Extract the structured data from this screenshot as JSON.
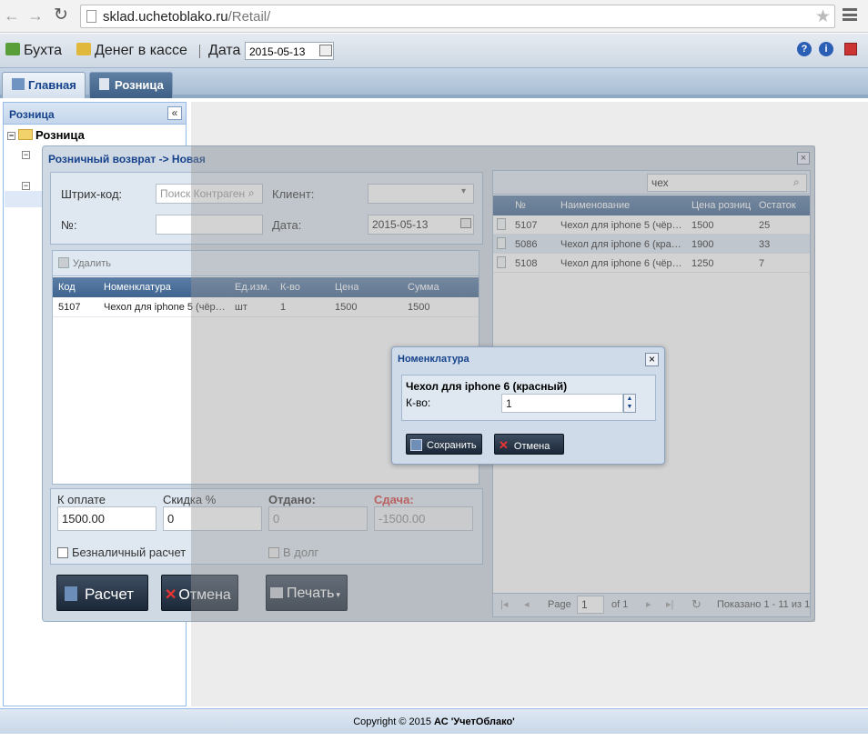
{
  "browser": {
    "url_host": "sklad.uchetoblako.ru",
    "url_path": "/Retail/"
  },
  "toolbar": {
    "buhta_label": "Бухта",
    "cash_label": "Денег в кассе",
    "date_label": "Дата",
    "date_value": "2015-05-13",
    "help_icon_text": "?",
    "info_icon_text": "i"
  },
  "tabs": [
    {
      "label": "Главная"
    },
    {
      "label": "Розница"
    }
  ],
  "left_panel": {
    "title": "Розница",
    "tree_root": "Розница"
  },
  "window": {
    "title": "Розничный возврат -> Новая",
    "barcode_label": "Штрих-код:",
    "barcode_placeholder": "Поиск Контраген",
    "client_label": "Клиент:",
    "number_label": "№:",
    "date_label": "Дата:",
    "date_value": "2015-05-13",
    "delete_label": "Удалить",
    "grid_columns": [
      "Код",
      "Номенклатура",
      "Ед.изм.",
      "К-во",
      "Цена",
      "Сумма"
    ],
    "grid_rows": [
      {
        "code": "5107",
        "name": "Чехол для iphone 5 (чёр…",
        "unit": "шт",
        "qty": "1",
        "price": "1500",
        "sum": "1500"
      }
    ],
    "to_pay_label": "К оплате",
    "to_pay_value": "1500.00",
    "discount_label": "Скидка %",
    "discount_value": "0",
    "given_label": "Отдано:",
    "given_value": "0",
    "change_label": "Сдача:",
    "change_value": "-1500.00",
    "cashless_label": "Безналичный расчет",
    "credit_label": "В долг",
    "calc_button": "Расчет",
    "cancel_button": "Отмена",
    "print_button": "Печать",
    "search_value": "чех",
    "right_columns": [
      "№",
      "Наименование",
      "Цена розниц",
      "Остаток"
    ],
    "right_rows": [
      {
        "no": "5107",
        "name": "Чехол для iphone 5 (чёр…",
        "price": "1500",
        "stock": "25"
      },
      {
        "no": "5086",
        "name": "Чехол для iphone 6 (кра…",
        "price": "1900",
        "stock": "33"
      },
      {
        "no": "5108",
        "name": "Чехол для iphone 6 (чёр…",
        "price": "1250",
        "stock": "7"
      }
    ],
    "pager_page_label": "Page",
    "pager_page_value": "1",
    "pager_of": "of 1",
    "pager_info": "Показано 1 - 11 из 1"
  },
  "modal": {
    "title": "Номенклатура",
    "item_name": "Чехол для iphone 6 (красный)",
    "qty_label": "К-во:",
    "qty_value": "1",
    "save_button": "Сохранить",
    "cancel_button": "Отмена"
  },
  "footer": {
    "text": "Copyright © 2015 ",
    "company": "АС 'УчетОблако'"
  }
}
